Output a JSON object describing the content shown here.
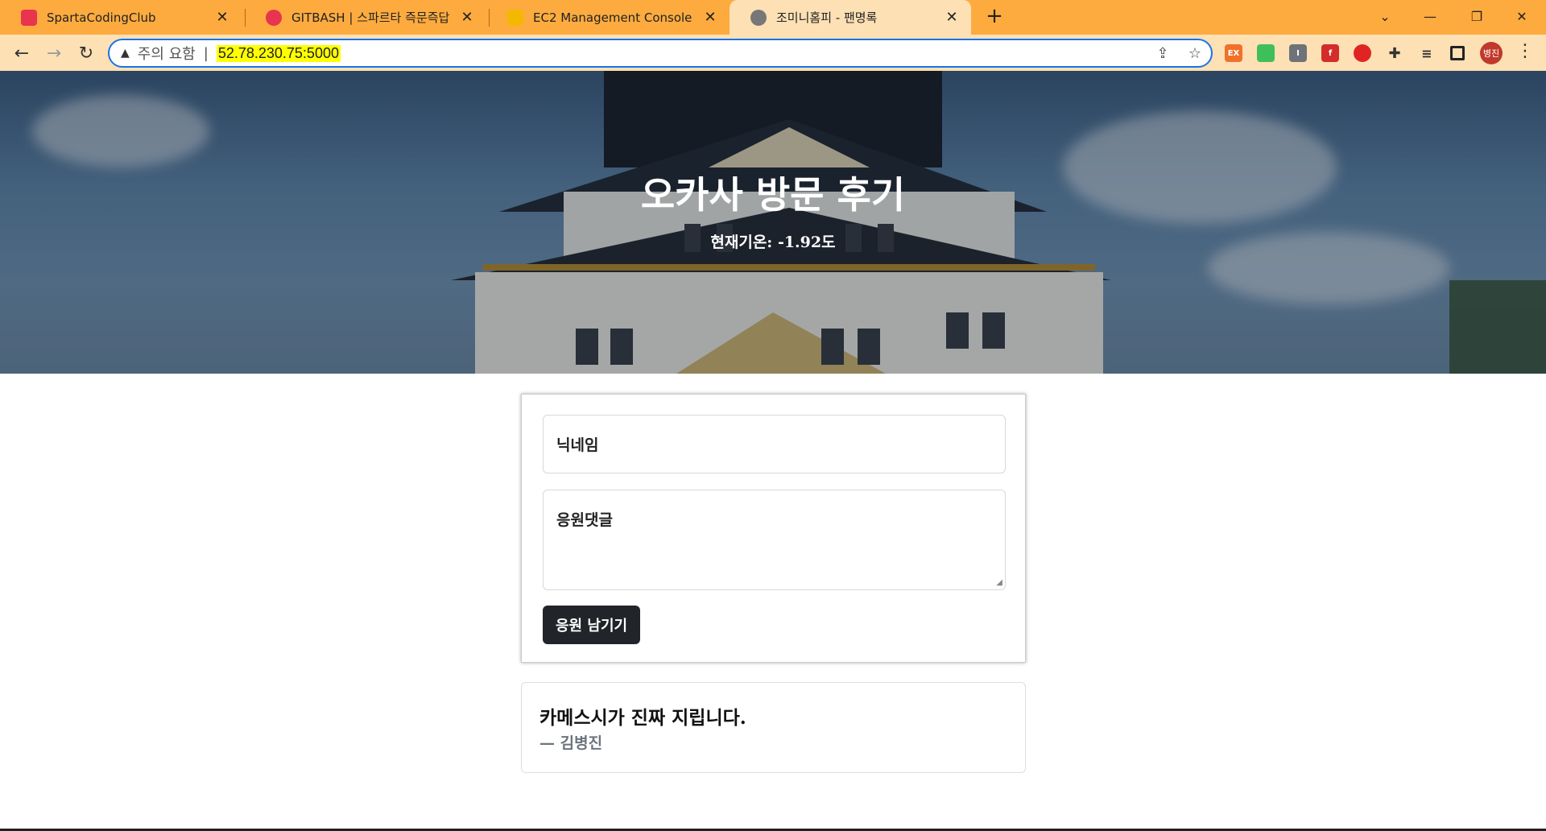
{
  "browser": {
    "tabs": [
      {
        "title": "SpartaCodingClub",
        "favicon": "sparta-icon",
        "color": "#e8344e"
      },
      {
        "title": "GITBASH | 스파르타 즉문즉답",
        "favicon": "heart-icon",
        "color": "#e8344e"
      },
      {
        "title": "EC2 Management Console",
        "favicon": "aws-icon",
        "color": "#f5b800"
      },
      {
        "title": "조미니홈피 - 팬명록",
        "favicon": "globe-icon",
        "color": "#555555"
      }
    ],
    "active_tab": 3,
    "address": {
      "security_label": "주의 요함",
      "url": "52.78.230.75:5000"
    },
    "extensions": [
      {
        "name": "ex-extension-icon",
        "label": "EX",
        "color": "#f0722a"
      },
      {
        "name": "green-extension-icon",
        "label": "",
        "color": "#3fbf5a"
      },
      {
        "name": "gray-extension-icon",
        "label": "I",
        "color": "#6d7378"
      },
      {
        "name": "flash-extension-icon",
        "label": "f",
        "color": "#d42b2b"
      },
      {
        "name": "adblock-extension-icon",
        "label": "",
        "color": "#e02424"
      }
    ],
    "profile_label": "병진"
  },
  "hero": {
    "title": "오카사 방문 후기",
    "temperature": "현재기온: -1.92도"
  },
  "form": {
    "name_placeholder": "닉네임",
    "comment_placeholder": "응원댓글",
    "submit_label": "응원 남기기"
  },
  "comments": [
    {
      "text": "카메스시가 진짜 지립니다.",
      "author": "— 김병진"
    }
  ]
}
